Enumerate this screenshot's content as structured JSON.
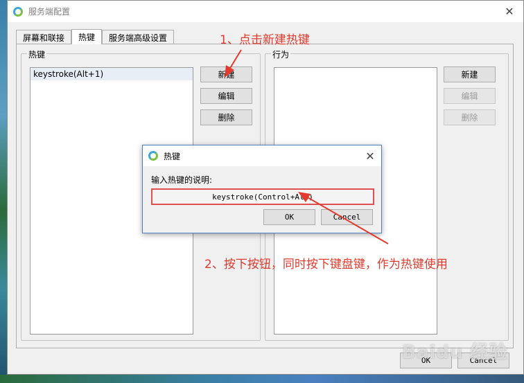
{
  "main_window": {
    "title": "服务端配置",
    "close_glyph": "✕",
    "tabs": [
      {
        "label": "屏幕和联接",
        "active": false
      },
      {
        "label": "热键",
        "active": true
      },
      {
        "label": "服务端高级设置",
        "active": false
      }
    ],
    "hotkeys_group": {
      "label": "热键",
      "items": [
        "keystroke(Alt+1)"
      ],
      "buttons": {
        "new": "新建",
        "edit": "编辑",
        "delete": "删除"
      }
    },
    "actions_group": {
      "label": "行为",
      "buttons": {
        "new": "新建",
        "edit": "编辑",
        "delete": "删除"
      }
    },
    "footer": {
      "ok": "OK",
      "cancel": "Cancel"
    }
  },
  "dialog": {
    "title": "热键",
    "close_glyph": "✕",
    "prompt": "输入热键的说明:",
    "field_value": "keystroke(Control+Alt)",
    "ok": "OK",
    "cancel": "Cancel"
  },
  "annotations": {
    "step1": "1、点击新建热键",
    "step2": "2、按下按钮，同时按下键盘键，作为热键使用",
    "color": "#e23b2e"
  },
  "watermark": "Baidu 经验"
}
